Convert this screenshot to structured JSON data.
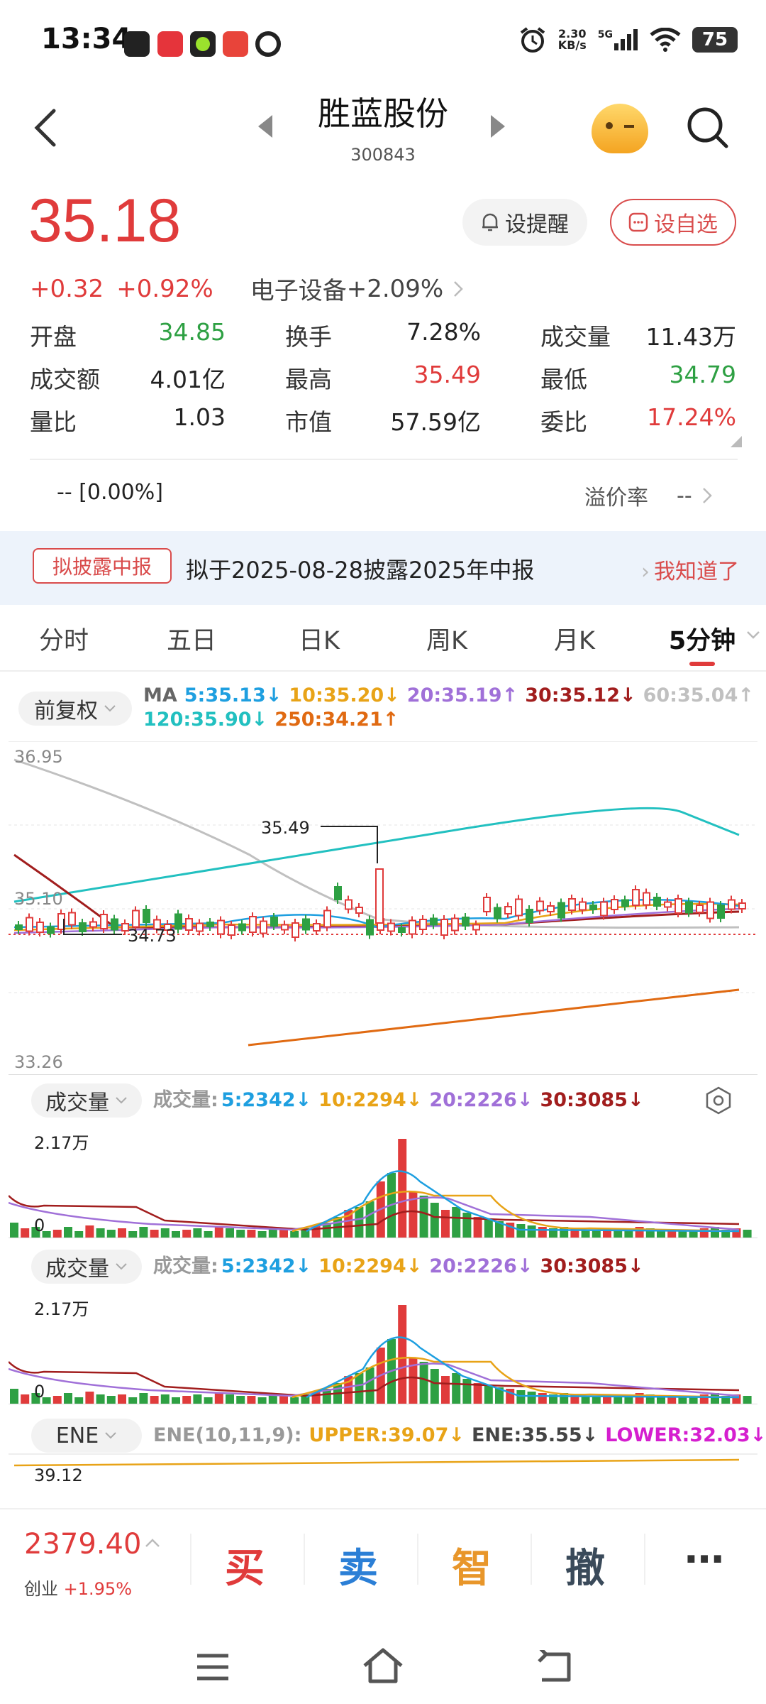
{
  "status_bar": {
    "time": "13:34",
    "net_speed": "2.30",
    "net_unit": "KB/s",
    "signal": "5G",
    "battery": "75"
  },
  "header": {
    "title": "胜蓝股份",
    "code": "300843"
  },
  "quote": {
    "price": "35.18",
    "change": "+0.32",
    "change_pct": "+0.92%",
    "sector": "电子设备",
    "sector_change": "+2.09%",
    "remind_label": "设提醒",
    "watch_label": "设自选",
    "stats": [
      [
        {
          "label": "开盘",
          "value": "34.85",
          "color": "green"
        },
        {
          "label": "换手",
          "value": "7.28%",
          "color": "dark"
        },
        {
          "label": "成交量",
          "value": "11.43万",
          "color": "dark"
        }
      ],
      [
        {
          "label": "成交额",
          "value": "4.01亿",
          "color": "dark"
        },
        {
          "label": "最高",
          "value": "35.49",
          "color": "red"
        },
        {
          "label": "最低",
          "value": "34.79",
          "color": "green"
        }
      ],
      [
        {
          "label": "量比",
          "value": "1.03",
          "color": "dark"
        },
        {
          "label": "市值",
          "value": "57.59亿",
          "color": "dark"
        },
        {
          "label": "委比",
          "value": "17.24%",
          "color": "red"
        }
      ]
    ],
    "premium_value": "--  [0.00%]",
    "premium_label": "溢价率",
    "premium_rate": "--"
  },
  "banner": {
    "tag": "拟披露中报",
    "text": "拟于2025-08-28披露2025年中报",
    "action": "我知道了"
  },
  "tabs": [
    "分时",
    "五日",
    "日K",
    "周K",
    "月K",
    "5分钟"
  ],
  "active_tab": "5分钟",
  "kline": {
    "adjust_label": "前复权",
    "ma_line1": [
      {
        "text": "MA",
        "color": "#666666"
      },
      {
        "text": "5:35.13↓",
        "color": "#1e9fe0"
      },
      {
        "text": "10:35.20↓",
        "color": "#e8a317"
      },
      {
        "text": "20:35.19↑",
        "color": "#a070d8"
      },
      {
        "text": "30:35.12↓",
        "color": "#a11d1d"
      },
      {
        "text": "60:35.04↑",
        "color": "#c0c0c0"
      }
    ],
    "ma_line2": [
      {
        "text": "120:35.90↓",
        "color": "#22c0c0"
      },
      {
        "text": "250:34.21↑",
        "color": "#e06a12"
      }
    ],
    "y_high": "36.95",
    "y_mid": "35.10",
    "y_low": "33.26",
    "max_label": "35.49",
    "min_label": "34.73"
  },
  "volume": {
    "selector": "成交量",
    "prefix": "成交量:",
    "items": [
      {
        "text": "5:2342↓",
        "color": "#1e9fe0"
      },
      {
        "text": "10:2294↓",
        "color": "#e8a317"
      },
      {
        "text": "20:2226↓",
        "color": "#a070d8"
      },
      {
        "text": "30:3085↓",
        "color": "#a11d1d"
      }
    ],
    "y_max": "2.17万",
    "y_zero": "0"
  },
  "ene": {
    "selector": "ENE",
    "params": "ENE(10,11,9):",
    "upper": "UPPER:39.07↓",
    "mid": "ENE:35.55↓",
    "lower": "LOWER:32.03↓",
    "y_val": "39.12"
  },
  "index_bar": {
    "value": "2379.40",
    "name": "创业",
    "change": "+1.95%"
  },
  "trade_buttons": [
    {
      "label": "买",
      "color": "#e03b3b"
    },
    {
      "label": "卖",
      "color": "#2b7fd6"
    },
    {
      "label": "智",
      "color": "#e8962a"
    },
    {
      "label": "撤",
      "color": "#3a4a5a"
    },
    {
      "label": "⋯",
      "color": "#333333"
    }
  ],
  "colors": {
    "up": "#e03b3b",
    "down": "#2ea043",
    "accent": "#d94c4c"
  },
  "chart_data": {
    "type": "candlestick",
    "title": "5分钟",
    "ylim": [
      33.26,
      36.95
    ],
    "max_price": 35.49,
    "min_price": 34.73,
    "last_price": 35.18
  }
}
